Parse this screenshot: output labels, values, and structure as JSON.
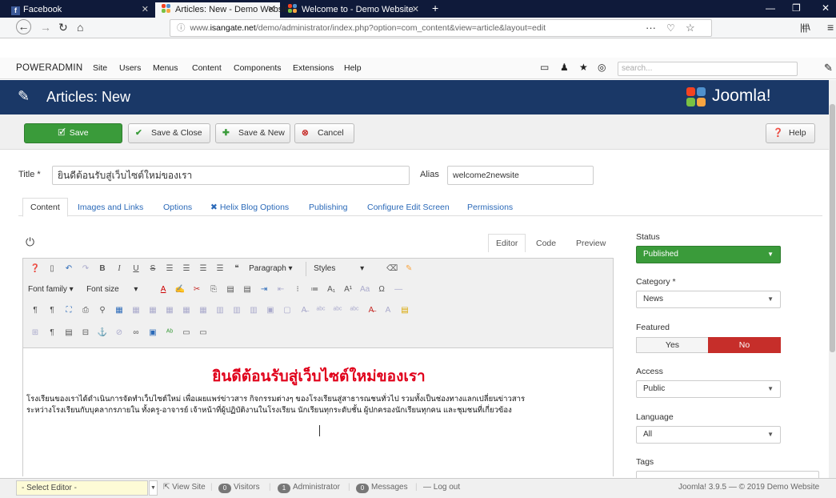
{
  "browser": {
    "tabs": [
      {
        "label": "Facebook",
        "active": false
      },
      {
        "label": "Articles: New - Demo Website",
        "active": true
      },
      {
        "label": "Welcome to - Demo Website",
        "active": false
      }
    ],
    "url_prefix": "www.",
    "url_domain": "isangate.net",
    "url_path": "/demo/administrator/index.php?option=com_content&view=article&layout=edit",
    "more_label": "···"
  },
  "joomla_nav": {
    "brand": "POWERADMIN",
    "menu": [
      "Site",
      "Users",
      "Menus",
      "Content",
      "Components",
      "Extensions",
      "Help"
    ],
    "search_placeholder": "search..."
  },
  "header": {
    "title": "Articles: New",
    "logo_text": "Joomla!"
  },
  "toolbar": {
    "save": "Save",
    "save_close": "Save & Close",
    "save_new": "Save & New",
    "cancel": "Cancel",
    "help": "Help"
  },
  "form": {
    "title_label": "Title *",
    "title_value": "ยินดีต้อนรับสู่เว็บไซต์ใหม่ของเรา",
    "alias_label": "Alias",
    "alias_value": "welcome2newsite"
  },
  "tabs": [
    "Content",
    "Images and Links",
    "Options",
    "Helix Blog Options",
    "Publishing",
    "Configure Edit Screen",
    "Permissions"
  ],
  "editor": {
    "tabs": [
      "Editor",
      "Code",
      "Preview"
    ],
    "paragraph": "Paragraph",
    "styles": "Styles",
    "font_family": "Font family",
    "font_size": "Font size",
    "content_title": "ยินดีต้อนรับสู่เว็บไซต์ใหม่ของเรา",
    "content_line1": "โรงเรียนของเราได้ดำเนินการจัดทำเว็บไซต์ใหม่ เพื่อเผยแพร่ข่าวสาร กิจกรรมต่างๆ ของโรงเรียนสู่สาธารณชนทั่วไป รวมทั้งเป็นช่องทางแลกเปลี่ยนข่าวสาร",
    "content_line2": "ระหว่างโรงเรียนกับบุคลากรภายใน ทั้งครู-อาจารย์ เจ้าหน้าที่ผู้ปฏิบัติงานในโรงเรียน นักเรียนทุกระดับชั้น ผู้ปกครองนักเรียนทุกคน และชุมชนที่เกี่ยวข้อง"
  },
  "sidebar": {
    "status_label": "Status",
    "status_value": "Published",
    "category_label": "Category *",
    "category_value": "News",
    "featured_label": "Featured",
    "featured_yes": "Yes",
    "featured_no": "No",
    "access_label": "Access",
    "access_value": "Public",
    "language_label": "Language",
    "language_value": "All",
    "tags_label": "Tags"
  },
  "footer": {
    "select_editor": "- Select Editor -",
    "view_site": "View Site",
    "visitors_count": "0",
    "visitors": "Visitors",
    "admin_count": "1",
    "administrator": "Administrator",
    "messages_count": "0",
    "messages": "Messages",
    "logout": "Log out",
    "version": "Joomla! 3.9.5 — © 2019 Demo Website"
  },
  "colors": {
    "header_bg": "#1a3867",
    "save_green": "#3a9b3a",
    "published_green": "#3a9b3a",
    "featured_no_red": "#c62e2a",
    "title_red": "#e0001a"
  }
}
